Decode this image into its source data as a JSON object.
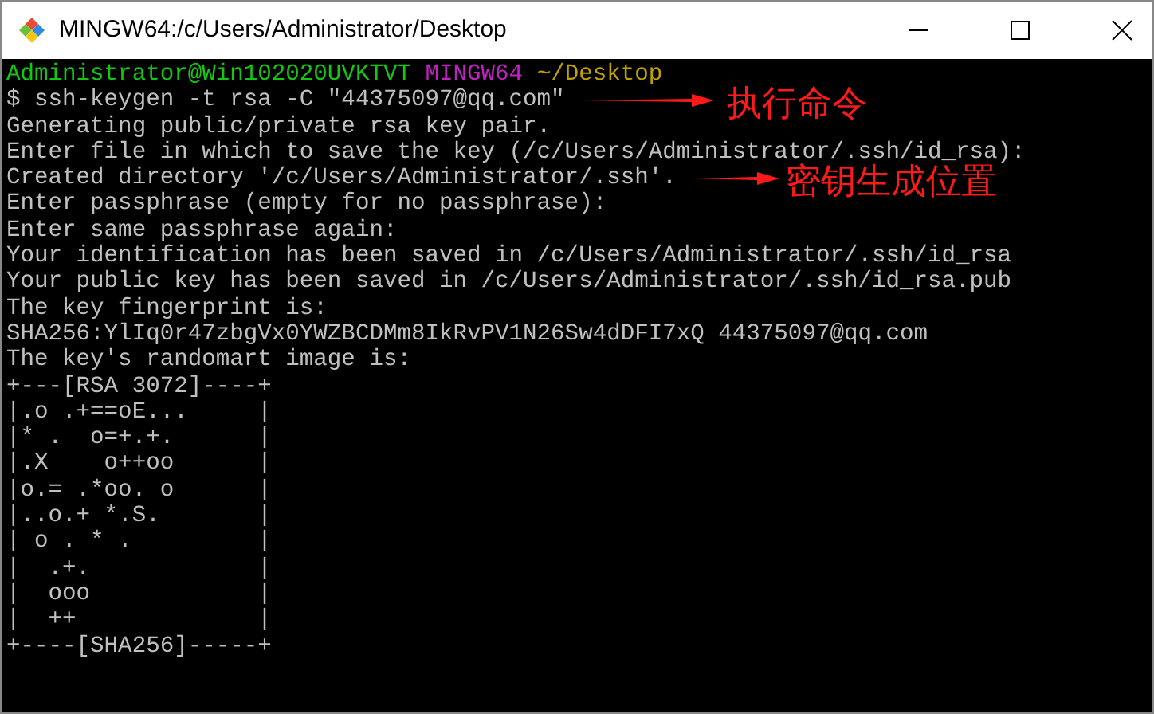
{
  "window": {
    "title": "MINGW64:/c/Users/Administrator/Desktop"
  },
  "prompt": {
    "user_host": "Administrator@Win102020UVKTVT",
    "system": "MINGW64",
    "path": "~/Desktop"
  },
  "lines": [
    "$ ssh-keygen -t rsa -C \"44375097@qq.com\"",
    "Generating public/private rsa key pair.",
    "Enter file in which to save the key (/c/Users/Administrator/.ssh/id_rsa):",
    "Created directory '/c/Users/Administrator/.ssh'.",
    "Enter passphrase (empty for no passphrase):",
    "Enter same passphrase again:",
    "Your identification has been saved in /c/Users/Administrator/.ssh/id_rsa",
    "Your public key has been saved in /c/Users/Administrator/.ssh/id_rsa.pub",
    "The key fingerprint is:",
    "SHA256:YlIq0r47zbgVx0YWZBCDMm8IkRvPV1N26Sw4dDFI7xQ 44375097@qq.com",
    "The key's randomart image is:",
    "+---[RSA 3072]----+",
    "|.o .+==oE...     |",
    "|* .  o=+.+.      |",
    "|.X    o++oo      |",
    "|o.= .*oo. o      |",
    "|..o.+ *.S.       |",
    "| o . * .         |",
    "|  .+.            |",
    "|  ooo            |",
    "|  ++             |",
    "+----[SHA256]-----+"
  ],
  "annotations": [
    {
      "text": "执行命令"
    },
    {
      "text": "密钥生成位置"
    }
  ]
}
